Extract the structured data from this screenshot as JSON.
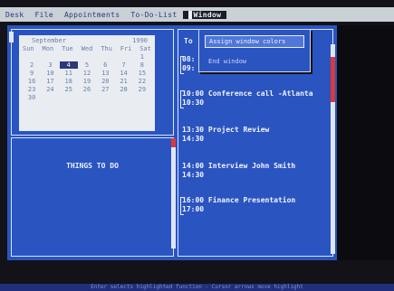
{
  "menubar": {
    "items": [
      "Desk",
      "File",
      "Appointments",
      "To-Do-List",
      "Window"
    ],
    "active_index": 4
  },
  "dropdown": {
    "items": [
      "Assign window colors",
      "End window"
    ],
    "highlight_index": 0
  },
  "calendar": {
    "month": "September",
    "year": "1990",
    "days": [
      "Sun",
      "Mon",
      "Tue",
      "Wed",
      "Thu",
      "Fri",
      "Sat"
    ],
    "rows": [
      [
        "",
        "",
        "",
        "",
        "",
        "",
        "1"
      ],
      [
        "2",
        "3",
        "4",
        "5",
        "6",
        "7",
        "8"
      ],
      [
        "9",
        "10",
        "11",
        "12",
        "13",
        "14",
        "15"
      ],
      [
        "16",
        "17",
        "18",
        "19",
        "20",
        "21",
        "22"
      ],
      [
        "23",
        "24",
        "25",
        "26",
        "27",
        "28",
        "29"
      ],
      [
        "30",
        "",
        "",
        "",
        "",
        "",
        ""
      ]
    ],
    "selected": "4"
  },
  "things": {
    "title": "THINGS TO DO"
  },
  "appointments": {
    "head": "To",
    "entries": [
      {
        "start": "08:",
        "end": "09:",
        "title": ""
      },
      {
        "start": "10:00",
        "end": "10:30",
        "title": "Conference call -Atlanta"
      },
      {
        "start": "13:30",
        "end": "14:30",
        "title": "Project Review"
      },
      {
        "start": "14:00",
        "end": "14:30",
        "title": "Interview John Smith"
      },
      {
        "start": "16:00",
        "end": "17:00",
        "title": "Finance Presentation"
      }
    ]
  },
  "status": {
    "text": "Enter selects highlighted function - Cursor arrows move highlight"
  }
}
